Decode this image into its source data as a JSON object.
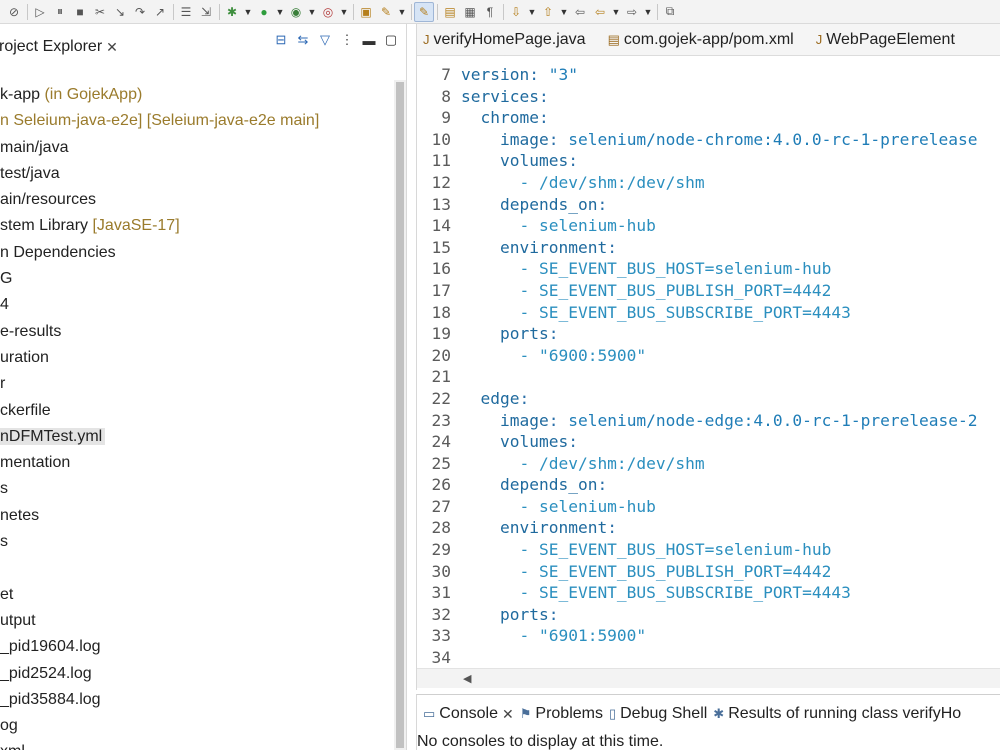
{
  "toolbar": {
    "icons": [
      "skip-all-icon",
      "resume-icon",
      "suspend-icon",
      "terminate-icon",
      "disconnect-icon",
      "step-into-icon",
      "step-over-icon",
      "step-return-icon",
      "drop-to-frame-icon",
      "use-step-filters-icon",
      "debug-icon",
      "run-icon",
      "coverage-icon",
      "external-tools-icon",
      "open-type-icon",
      "new-icon",
      "toggle-mark-icon",
      "toggle-breadcrumb-icon",
      "show-whitespace-icon",
      "next-annotation-icon",
      "previous-annotation-icon",
      "last-edit-icon",
      "back-icon",
      "forward-icon",
      "pin-editor-icon"
    ]
  },
  "explorer": {
    "title": "roject Explorer",
    "close_glyph": "✕",
    "tree": [
      {
        "label": "k-app",
        "decoration": " (in GojekApp)"
      },
      {
        "label": "",
        "decoration": "n Seleium-java-e2e] [Seleium-java-e2e main]"
      },
      {
        "label": "main/java",
        "decoration": ""
      },
      {
        "label": "test/java",
        "decoration": ""
      },
      {
        "label": "ain/resources",
        "decoration": ""
      },
      {
        "label": "stem Library",
        "decoration": " [JavaSE-17]"
      },
      {
        "label": "n Dependencies",
        "decoration": ""
      },
      {
        "label": "G",
        "decoration": ""
      },
      {
        "label": "4",
        "decoration": ""
      },
      {
        "label": "e-results",
        "decoration": ""
      },
      {
        "label": "uration",
        "decoration": ""
      },
      {
        "label": "r",
        "decoration": ""
      },
      {
        "label": "ckerfile",
        "decoration": ""
      },
      {
        "label": "nDFMTest.yml",
        "decoration": "",
        "selected": true
      },
      {
        "label": "mentation",
        "decoration": ""
      },
      {
        "label": "s",
        "decoration": ""
      },
      {
        "label": "netes",
        "decoration": ""
      },
      {
        "label": "s",
        "decoration": ""
      },
      {
        "label": "",
        "decoration": ""
      },
      {
        "label": "et",
        "decoration": ""
      },
      {
        "label": "utput",
        "decoration": ""
      },
      {
        "label": "_pid19604.log",
        "decoration": ""
      },
      {
        "label": "_pid2524.log",
        "decoration": ""
      },
      {
        "label": "_pid35884.log",
        "decoration": ""
      },
      {
        "label": "og",
        "decoration": ""
      },
      {
        "label": "xml",
        "decoration": ""
      }
    ]
  },
  "editor": {
    "tabs": [
      {
        "label": "verifyHomePage.java",
        "icon": "java-file-icon"
      },
      {
        "label": "com.gojek-app/pom.xml",
        "icon": "xml-file-icon"
      },
      {
        "label": "WebPageElement",
        "icon": "java-file-icon"
      }
    ],
    "lines": [
      {
        "n": "7",
        "code": "version: \"3\""
      },
      {
        "n": "8",
        "code": "services:"
      },
      {
        "n": "9",
        "code": "  chrome:"
      },
      {
        "n": "10",
        "code": "    image: selenium/node-chrome:4.0.0-rc-1-prerelease"
      },
      {
        "n": "11",
        "code": "    volumes:"
      },
      {
        "n": "12",
        "code": "      - /dev/shm:/dev/shm"
      },
      {
        "n": "13",
        "code": "    depends_on:"
      },
      {
        "n": "14",
        "code": "      - selenium-hub"
      },
      {
        "n": "15",
        "code": "    environment:"
      },
      {
        "n": "16",
        "code": "      - SE_EVENT_BUS_HOST=selenium-hub"
      },
      {
        "n": "17",
        "code": "      - SE_EVENT_BUS_PUBLISH_PORT=4442"
      },
      {
        "n": "18",
        "code": "      - SE_EVENT_BUS_SUBSCRIBE_PORT=4443"
      },
      {
        "n": "19",
        "code": "    ports:"
      },
      {
        "n": "20",
        "code": "      - \"6900:5900\""
      },
      {
        "n": "21",
        "code": ""
      },
      {
        "n": "22",
        "code": "  edge:"
      },
      {
        "n": "23",
        "code": "    image: selenium/node-edge:4.0.0-rc-1-prerelease-2"
      },
      {
        "n": "24",
        "code": "    volumes:"
      },
      {
        "n": "25",
        "code": "      - /dev/shm:/dev/shm"
      },
      {
        "n": "26",
        "code": "    depends_on:"
      },
      {
        "n": "27",
        "code": "      - selenium-hub"
      },
      {
        "n": "28",
        "code": "    environment:"
      },
      {
        "n": "29",
        "code": "      - SE_EVENT_BUS_HOST=selenium-hub"
      },
      {
        "n": "30",
        "code": "      - SE_EVENT_BUS_PUBLISH_PORT=4442"
      },
      {
        "n": "31",
        "code": "      - SE_EVENT_BUS_SUBSCRIBE_PORT=4443"
      },
      {
        "n": "32",
        "code": "    ports:"
      },
      {
        "n": "33",
        "code": "      - \"6901:5900\""
      },
      {
        "n": "34",
        "code": ""
      }
    ]
  },
  "console": {
    "tabs": [
      {
        "label": "Console",
        "icon": "console-icon",
        "closable": true
      },
      {
        "label": "Problems",
        "icon": "problems-icon",
        "closable": false
      },
      {
        "label": "Debug Shell",
        "icon": "debug-shell-icon",
        "closable": false
      },
      {
        "label": "Results of running class verifyHo",
        "icon": "testng-results-icon",
        "closable": false
      }
    ],
    "message": "No consoles to display at this time."
  }
}
